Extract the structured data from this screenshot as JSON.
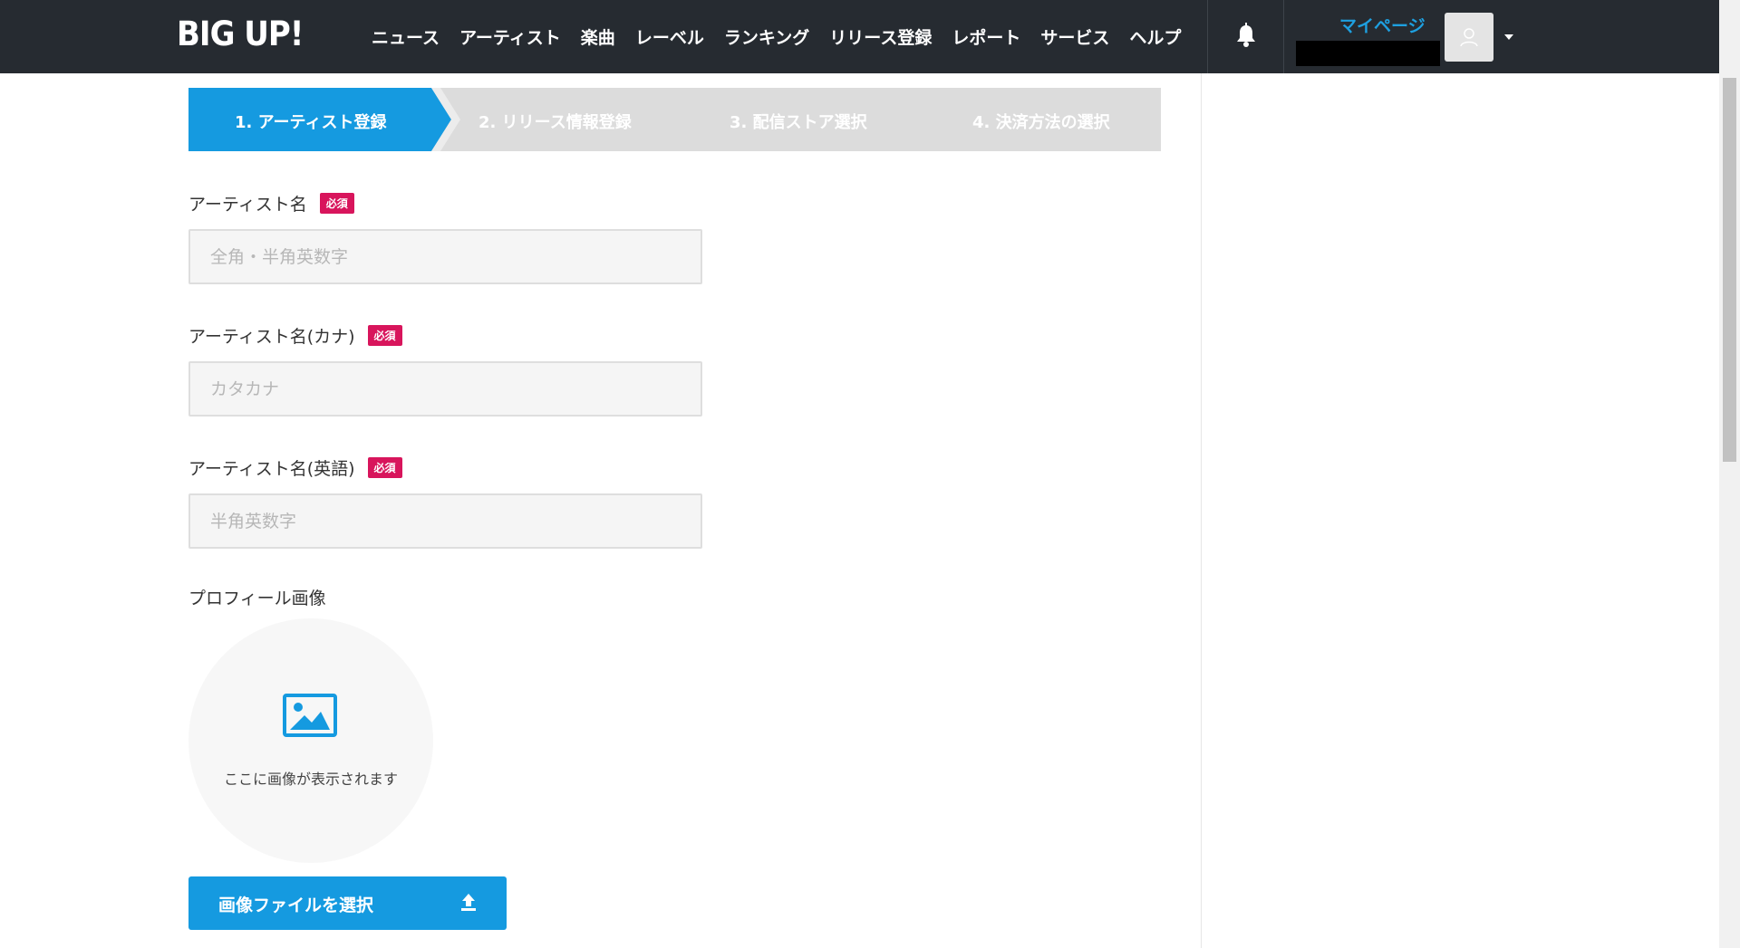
{
  "header": {
    "logo": "BIG UP!",
    "nav": [
      "ニュース",
      "アーティスト",
      "楽曲",
      "レーベル",
      "ランキング",
      "リリース登録",
      "レポート",
      "サービス",
      "ヘルプ"
    ],
    "mypage": "マイページ",
    "icons": {
      "notification": "bell-icon",
      "avatar": "user-icon",
      "menu": "chevron-down-icon"
    }
  },
  "stepper": {
    "steps": [
      "1. アーティスト登録",
      "2. リリース情報登録",
      "3. 配信ストア選択",
      "4. 決済方法の選択"
    ],
    "active_index": 0
  },
  "form": {
    "required_badge": "必須",
    "fields": [
      {
        "label": "アーティスト名",
        "placeholder": "全角・半角英数字",
        "value": ""
      },
      {
        "label": "アーティスト名(カナ)",
        "placeholder": "カタカナ",
        "value": ""
      },
      {
        "label": "アーティスト名(英語)",
        "placeholder": "半角英数字",
        "value": ""
      }
    ],
    "profile_image": {
      "label": "プロフィール画像",
      "caption": "ここに画像が表示されます",
      "icon": "image-icon"
    },
    "upload_button": {
      "label": "画像ファイルを選択",
      "icon": "upload-icon"
    }
  },
  "colors": {
    "header_bg": "#262b31",
    "accent": "#159ae0",
    "required": "#d8155c",
    "stepper_inactive": "#dcdcdc"
  }
}
